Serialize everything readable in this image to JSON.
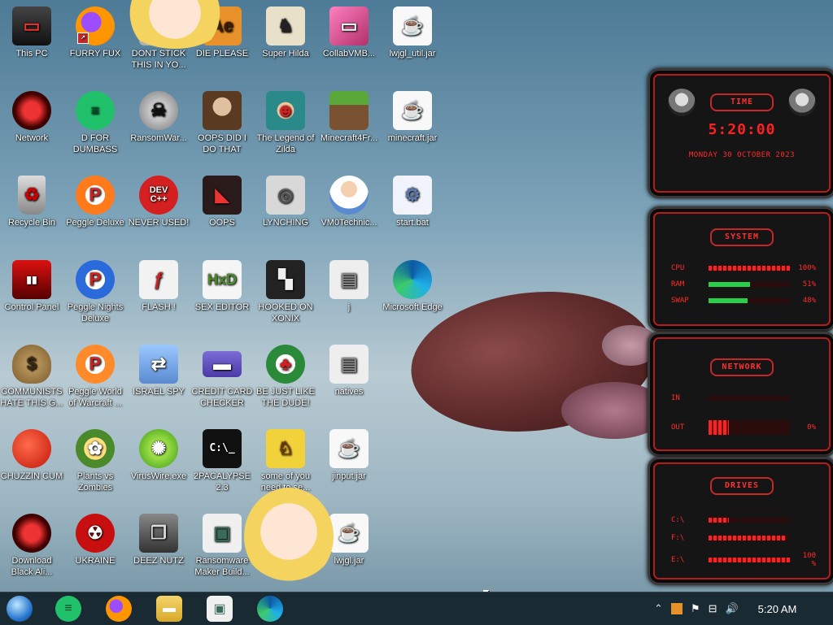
{
  "desktop_icons": [
    {
      "label": "This PC"
    },
    {
      "label": "Network"
    },
    {
      "label": "Recycle Bin"
    },
    {
      "label": "Control Panel"
    },
    {
      "label": "COMMUNISTS HATE THIS G..."
    },
    {
      "label": "CHUZZIN CUM"
    },
    {
      "label": "Download Black Ali..."
    },
    {
      "label": "FURRY FUX"
    },
    {
      "label": "D FOR DUMBASS"
    },
    {
      "label": "Peggle Deluxe"
    },
    {
      "label": "Peggle Nights Deluxe"
    },
    {
      "label": "Peggle World of Warcraft ..."
    },
    {
      "label": "Plants vs Zombies"
    },
    {
      "label": "UKRAINE"
    },
    {
      "label": "DONT STICK THIS IN YO..."
    },
    {
      "label": "RansomWar..."
    },
    {
      "label": "NEVER USED!"
    },
    {
      "label": "FLASH !"
    },
    {
      "label": "ISRAEL SPY"
    },
    {
      "label": "VirusWire.exe"
    },
    {
      "label": "DEEZ NUTZ"
    },
    {
      "label": "DIE PLEASE"
    },
    {
      "label": "OOPS DID I DO THAT"
    },
    {
      "label": "OOPS"
    },
    {
      "label": "SEX EDITOR"
    },
    {
      "label": "CREDIT CARD CHECKER"
    },
    {
      "label": "2PACALYPSE 2.3"
    },
    {
      "label": "Ransomware Maker Build..."
    },
    {
      "label": "Super Hilda"
    },
    {
      "label": "The Legend of Zilda"
    },
    {
      "label": "LYNCHING"
    },
    {
      "label": "HOOKED ON XONIX"
    },
    {
      "label": "BE JUST LIKE THE DUDE!"
    },
    {
      "label": "some of you need to se..."
    },
    {
      "label": "CollabVMB..."
    },
    {
      "label": "Minecraft4Fr..."
    },
    {
      "label": "VM0Technic..."
    },
    {
      "label": "j"
    },
    {
      "label": "natives"
    },
    {
      "label": "jinput.jar"
    },
    {
      "label": "lwjgl.jar"
    },
    {
      "label": "lwjgl_util.jar"
    },
    {
      "label": "minecraft.jar"
    },
    {
      "label": "start.bat"
    },
    {
      "label": "Microsoft Edge"
    }
  ],
  "widgets": {
    "time": {
      "title": "TIME",
      "clock": "5:20:00",
      "date": "MONDAY 30 OCTOBER 2023"
    },
    "system": {
      "title": "SYSTEM",
      "rows": [
        {
          "key": "CPU",
          "value": "100%",
          "level": 1.0
        },
        {
          "key": "RAM",
          "value": "51%",
          "level": 0.51
        },
        {
          "key": "SWAP",
          "value": "48%",
          "level": 0.48
        }
      ]
    },
    "network": {
      "title": "NETWORK",
      "rows": [
        {
          "key": "IN",
          "value": "",
          "level": 0.0
        },
        {
          "key": "OUT",
          "value": "0%",
          "level": 0.25
        }
      ]
    },
    "drives": {
      "title": "DRIVES",
      "rows": [
        {
          "key": "C:\\",
          "value": "",
          "level": 0.25
        },
        {
          "key": "F:\\",
          "value": "",
          "level": 0.95
        },
        {
          "key": "E:\\",
          "value": "100 %",
          "level": 1.0
        }
      ]
    }
  },
  "taskbar": {
    "clock": "5:20 AM",
    "apps": [
      "start-orb-icon",
      "doc-app-icon",
      "firefox-icon",
      "file-explorer-icon",
      "window-app-icon",
      "edge-icon"
    ]
  }
}
